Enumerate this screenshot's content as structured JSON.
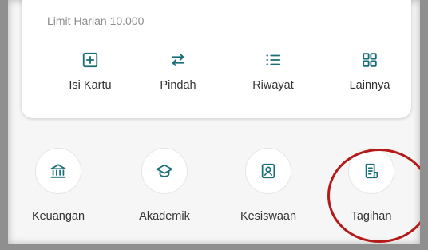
{
  "card": {
    "limit_text": "Limit Harian 10.000",
    "actions": [
      {
        "label": "Isi Kartu",
        "icon": "plus-square-icon"
      },
      {
        "label": "Pindah",
        "icon": "transfer-arrows-icon"
      },
      {
        "label": "Riwayat",
        "icon": "list-icon"
      },
      {
        "label": "Lainnya",
        "icon": "grid-icon"
      }
    ]
  },
  "menu": [
    {
      "label": "Keuangan",
      "icon": "bank-icon"
    },
    {
      "label": "Akademik",
      "icon": "graduation-cap-icon"
    },
    {
      "label": "Kesiswaan",
      "icon": "student-id-icon"
    },
    {
      "label": "Tagihan",
      "icon": "bill-icon"
    }
  ],
  "colors": {
    "accent": "#1a6e78",
    "highlight": "#b51a1a",
    "text": "#333333",
    "muted": "#8c8c8c"
  }
}
